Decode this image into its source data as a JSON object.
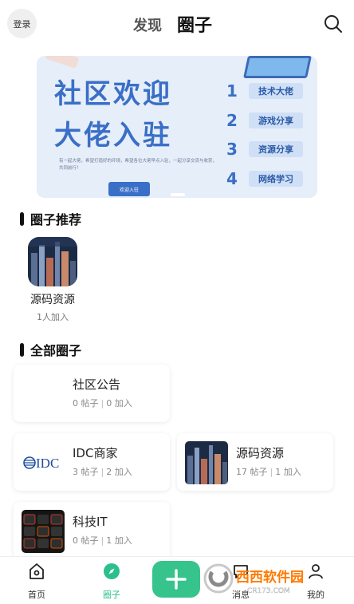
{
  "header": {
    "login_label": "登录",
    "tabs": [
      {
        "label": "发现",
        "active": false
      },
      {
        "label": "圈子",
        "active": true
      }
    ]
  },
  "banner": {
    "title_line1": "社区欢迎",
    "title_line2": "大佬入驻",
    "subtitle": "有一起大佬，希望打造好的环境，希望各位大佬早点入驻，一起分享交流与收获，共同前行！",
    "join_label": "欢迎入驻",
    "items": [
      {
        "num": "1",
        "label": "技术大佬"
      },
      {
        "num": "2",
        "label": "游戏分享"
      },
      {
        "num": "3",
        "label": "资源分享"
      },
      {
        "num": "4",
        "label": "网络学习"
      }
    ]
  },
  "recommended": {
    "title": "圈子推荐",
    "items": [
      {
        "name": "源码资源",
        "count": "1人加入"
      }
    ]
  },
  "all_circles": {
    "title": "全部圈子",
    "cards": [
      {
        "name": "社区公告",
        "posts": "0 帖子",
        "joins": "0 加入",
        "thumb": "none"
      },
      {
        "name": "IDC商家",
        "posts": "3 帖子",
        "joins": "2 加入",
        "thumb": "idc-logo"
      },
      {
        "name": "源码资源",
        "posts": "17 帖子",
        "joins": "1 加入",
        "thumb": "city-photo"
      },
      {
        "name": "科技IT",
        "posts": "0 帖子",
        "joins": "1 加入",
        "thumb": "keyboard-photo"
      }
    ],
    "idc_logo_text": "IDC"
  },
  "bottom_nav": {
    "items": [
      {
        "label": "首页",
        "icon": "home-icon",
        "active": false
      },
      {
        "label": "圈子",
        "icon": "compass-icon",
        "active": true
      },
      {
        "label": "消息",
        "icon": "message-icon",
        "active": false
      },
      {
        "label": "我的",
        "icon": "user-icon",
        "active": false
      }
    ]
  },
  "watermark": {
    "brand": "西西软件园",
    "url": "CR173.COM"
  },
  "colors": {
    "accent": "#36c38c",
    "banner_blue": "#3a6fc7",
    "banner_bg": "#e6eef9"
  }
}
